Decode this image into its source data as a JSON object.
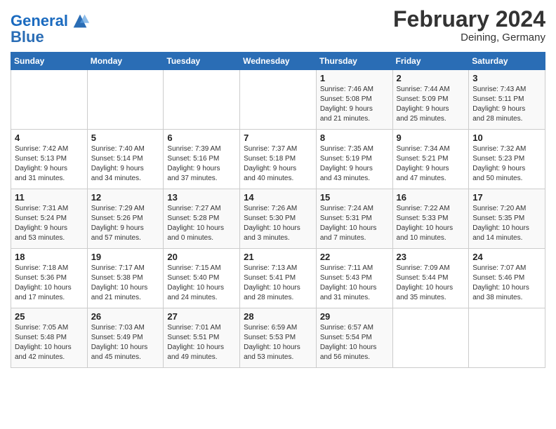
{
  "header": {
    "logo_general": "General",
    "logo_blue": "Blue",
    "title": "February 2024",
    "subtitle": "Deining, Germany"
  },
  "days_of_week": [
    "Sunday",
    "Monday",
    "Tuesday",
    "Wednesday",
    "Thursday",
    "Friday",
    "Saturday"
  ],
  "weeks": [
    [
      {
        "day": "",
        "content": ""
      },
      {
        "day": "",
        "content": ""
      },
      {
        "day": "",
        "content": ""
      },
      {
        "day": "",
        "content": ""
      },
      {
        "day": "1",
        "content": "Sunrise: 7:46 AM\nSunset: 5:08 PM\nDaylight: 9 hours\nand 21 minutes."
      },
      {
        "day": "2",
        "content": "Sunrise: 7:44 AM\nSunset: 5:09 PM\nDaylight: 9 hours\nand 25 minutes."
      },
      {
        "day": "3",
        "content": "Sunrise: 7:43 AM\nSunset: 5:11 PM\nDaylight: 9 hours\nand 28 minutes."
      }
    ],
    [
      {
        "day": "4",
        "content": "Sunrise: 7:42 AM\nSunset: 5:13 PM\nDaylight: 9 hours\nand 31 minutes."
      },
      {
        "day": "5",
        "content": "Sunrise: 7:40 AM\nSunset: 5:14 PM\nDaylight: 9 hours\nand 34 minutes."
      },
      {
        "day": "6",
        "content": "Sunrise: 7:39 AM\nSunset: 5:16 PM\nDaylight: 9 hours\nand 37 minutes."
      },
      {
        "day": "7",
        "content": "Sunrise: 7:37 AM\nSunset: 5:18 PM\nDaylight: 9 hours\nand 40 minutes."
      },
      {
        "day": "8",
        "content": "Sunrise: 7:35 AM\nSunset: 5:19 PM\nDaylight: 9 hours\nand 43 minutes."
      },
      {
        "day": "9",
        "content": "Sunrise: 7:34 AM\nSunset: 5:21 PM\nDaylight: 9 hours\nand 47 minutes."
      },
      {
        "day": "10",
        "content": "Sunrise: 7:32 AM\nSunset: 5:23 PM\nDaylight: 9 hours\nand 50 minutes."
      }
    ],
    [
      {
        "day": "11",
        "content": "Sunrise: 7:31 AM\nSunset: 5:24 PM\nDaylight: 9 hours\nand 53 minutes."
      },
      {
        "day": "12",
        "content": "Sunrise: 7:29 AM\nSunset: 5:26 PM\nDaylight: 9 hours\nand 57 minutes."
      },
      {
        "day": "13",
        "content": "Sunrise: 7:27 AM\nSunset: 5:28 PM\nDaylight: 10 hours\nand 0 minutes."
      },
      {
        "day": "14",
        "content": "Sunrise: 7:26 AM\nSunset: 5:30 PM\nDaylight: 10 hours\nand 3 minutes."
      },
      {
        "day": "15",
        "content": "Sunrise: 7:24 AM\nSunset: 5:31 PM\nDaylight: 10 hours\nand 7 minutes."
      },
      {
        "day": "16",
        "content": "Sunrise: 7:22 AM\nSunset: 5:33 PM\nDaylight: 10 hours\nand 10 minutes."
      },
      {
        "day": "17",
        "content": "Sunrise: 7:20 AM\nSunset: 5:35 PM\nDaylight: 10 hours\nand 14 minutes."
      }
    ],
    [
      {
        "day": "18",
        "content": "Sunrise: 7:18 AM\nSunset: 5:36 PM\nDaylight: 10 hours\nand 17 minutes."
      },
      {
        "day": "19",
        "content": "Sunrise: 7:17 AM\nSunset: 5:38 PM\nDaylight: 10 hours\nand 21 minutes."
      },
      {
        "day": "20",
        "content": "Sunrise: 7:15 AM\nSunset: 5:40 PM\nDaylight: 10 hours\nand 24 minutes."
      },
      {
        "day": "21",
        "content": "Sunrise: 7:13 AM\nSunset: 5:41 PM\nDaylight: 10 hours\nand 28 minutes."
      },
      {
        "day": "22",
        "content": "Sunrise: 7:11 AM\nSunset: 5:43 PM\nDaylight: 10 hours\nand 31 minutes."
      },
      {
        "day": "23",
        "content": "Sunrise: 7:09 AM\nSunset: 5:44 PM\nDaylight: 10 hours\nand 35 minutes."
      },
      {
        "day": "24",
        "content": "Sunrise: 7:07 AM\nSunset: 5:46 PM\nDaylight: 10 hours\nand 38 minutes."
      }
    ],
    [
      {
        "day": "25",
        "content": "Sunrise: 7:05 AM\nSunset: 5:48 PM\nDaylight: 10 hours\nand 42 minutes."
      },
      {
        "day": "26",
        "content": "Sunrise: 7:03 AM\nSunset: 5:49 PM\nDaylight: 10 hours\nand 45 minutes."
      },
      {
        "day": "27",
        "content": "Sunrise: 7:01 AM\nSunset: 5:51 PM\nDaylight: 10 hours\nand 49 minutes."
      },
      {
        "day": "28",
        "content": "Sunrise: 6:59 AM\nSunset: 5:53 PM\nDaylight: 10 hours\nand 53 minutes."
      },
      {
        "day": "29",
        "content": "Sunrise: 6:57 AM\nSunset: 5:54 PM\nDaylight: 10 hours\nand 56 minutes."
      },
      {
        "day": "",
        "content": ""
      },
      {
        "day": "",
        "content": ""
      }
    ]
  ]
}
